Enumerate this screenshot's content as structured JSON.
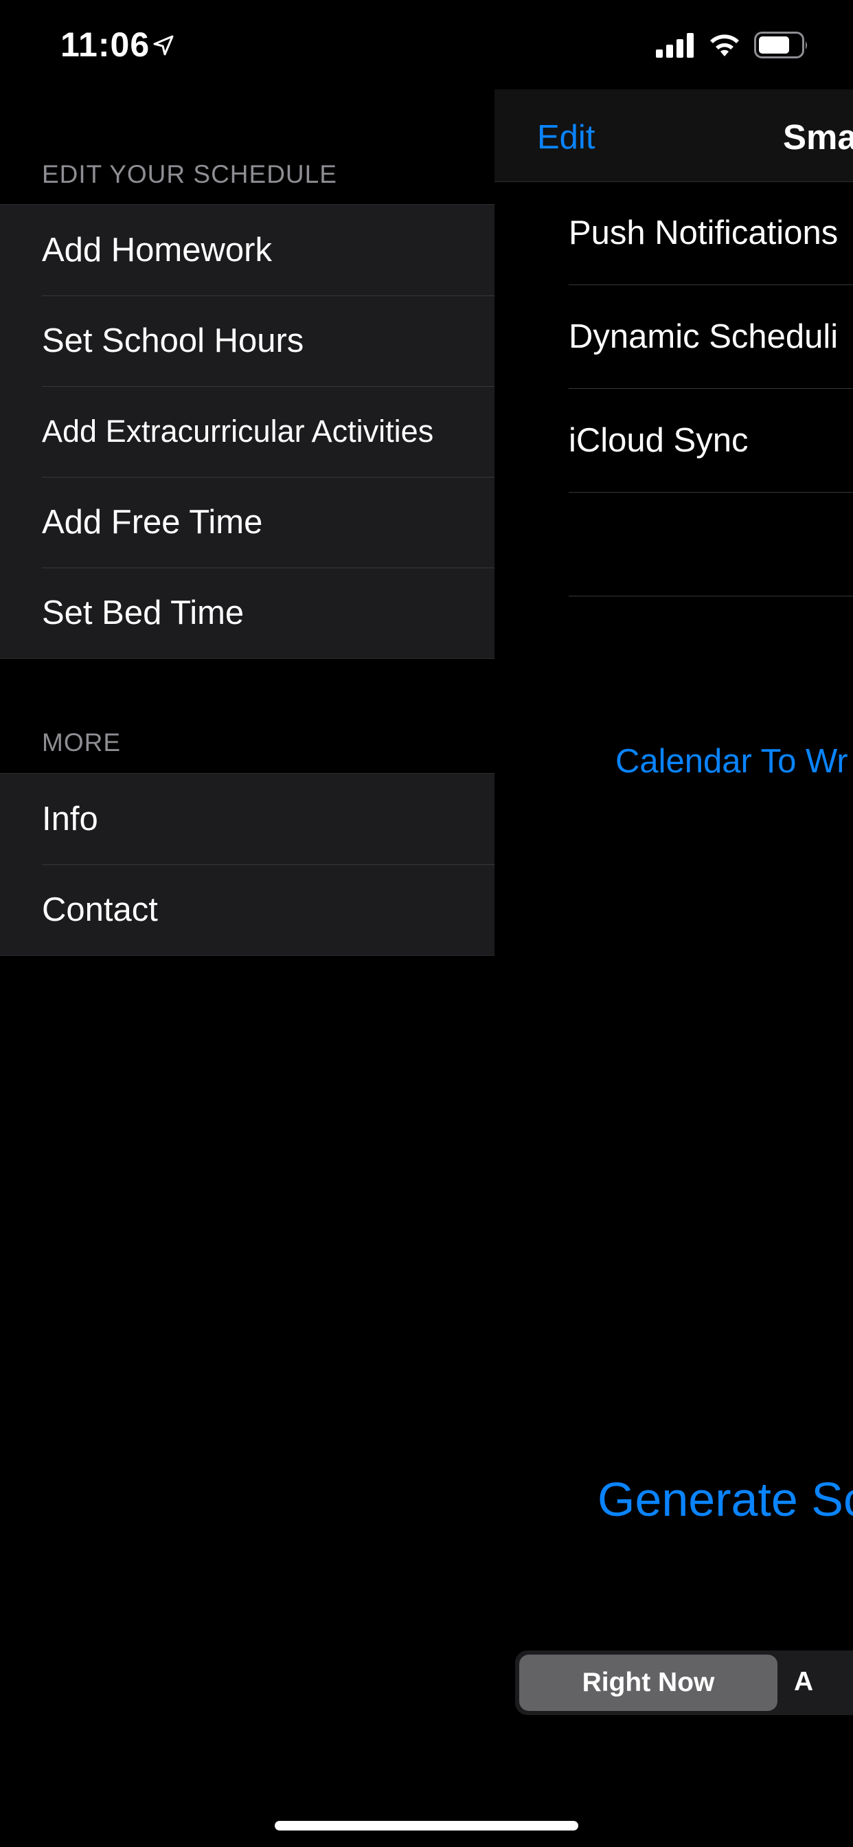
{
  "status_bar": {
    "time": "11:06",
    "icons": [
      "location-arrow-icon",
      "cellular-signal-icon",
      "wifi-icon",
      "battery-icon"
    ]
  },
  "menu": {
    "edit_section": {
      "header": "EDIT YOUR SCHEDULE",
      "items": [
        "Add Homework",
        "Set School Hours",
        "Add Extracurricular Activities",
        "Add Free Time",
        "Set Bed Time"
      ]
    },
    "more_section": {
      "header": "MORE",
      "items": [
        "Info",
        "Contact"
      ]
    }
  },
  "main": {
    "navbar": {
      "edit_label": "Edit",
      "title": "Sma"
    },
    "settings": [
      "Push Notifications",
      "Dynamic Scheduli",
      "iCloud Sync",
      ""
    ],
    "calendar_link": "Calendar To Wr",
    "generate_label": "Generate Sc",
    "segmented": {
      "active": "Right Now",
      "other": "A"
    }
  },
  "colors": {
    "accent": "#0a84ff",
    "background": "#000000",
    "cell": "#1c1c1e",
    "secondary_text": "#8e8e93"
  }
}
